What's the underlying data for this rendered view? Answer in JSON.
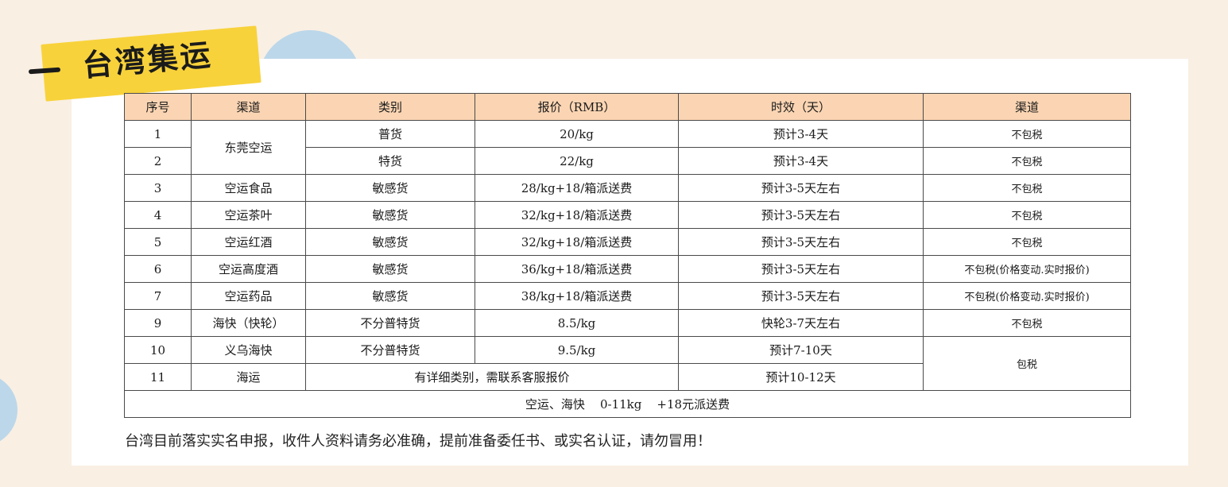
{
  "header": {
    "title": "台湾集运"
  },
  "table": {
    "headers": [
      "序号",
      "渠道",
      "类别",
      "报价（RMB）",
      "时效（天）",
      "渠道"
    ],
    "rows": [
      {
        "no": "1",
        "channel": "东莞空运",
        "category": "普货",
        "price": "20/kg",
        "time": "预计3-4天",
        "note": "不包税"
      },
      {
        "no": "2",
        "category": "特货",
        "price": "22/kg",
        "time": "预计3-4天",
        "note": "不包税"
      },
      {
        "no": "3",
        "channel": "空运食品",
        "category": "敏感货",
        "price": "28/kg+18/箱派送费",
        "time": "预计3-5天左右",
        "note": "不包税"
      },
      {
        "no": "4",
        "channel": "空运茶叶",
        "category": "敏感货",
        "price": "32/kg+18/箱派送费",
        "time": "预计3-5天左右",
        "note": "不包税"
      },
      {
        "no": "5",
        "channel": "空运红酒",
        "category": "敏感货",
        "price": "32/kg+18/箱派送费",
        "time": "预计3-5天左右",
        "note": "不包税"
      },
      {
        "no": "6",
        "channel": "空运高度酒",
        "category": "敏感货",
        "price": "36/kg+18/箱派送费",
        "time": "预计3-5天左右",
        "note": "不包税(价格变动.实时报价)"
      },
      {
        "no": "7",
        "channel": "空运药品",
        "category": "敏感货",
        "price": "38/kg+18/箱派送费",
        "time": "预计3-5天左右",
        "note": "不包税(价格变动.实时报价)"
      },
      {
        "no": "9",
        "channel": "海快（快轮）",
        "category": "不分普特货",
        "price": "8.5/kg",
        "time": "快轮3-7天左右",
        "note": "不包税"
      },
      {
        "no": "10",
        "channel": "义乌海快",
        "category": "不分普特货",
        "price": "9.5/kg",
        "time": "预计7-10天",
        "note": "包税"
      },
      {
        "no": "11",
        "channel": "海运",
        "category_price": "有详细类别，需联系客服报价",
        "time": "预计10-12天"
      }
    ],
    "summary": "空运、海快    0-11kg    +18元派送费"
  },
  "footer_note": "台湾目前落实实名申报，收件人资料请务必准确，提前准备委任书、或实名认证，请勿冒用！"
}
